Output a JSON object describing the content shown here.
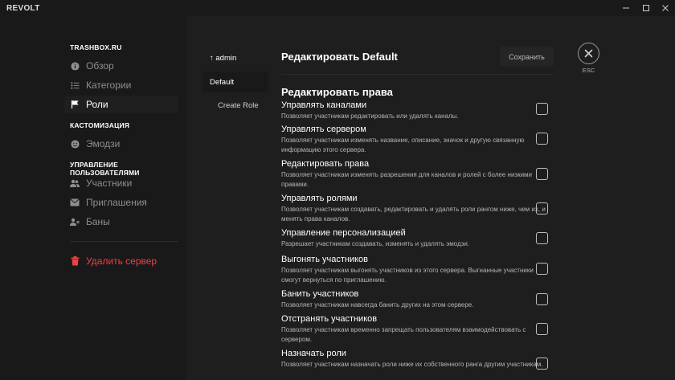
{
  "window": {
    "title": "REVOLT"
  },
  "sidebar": {
    "server_name": "TRASHBOX.RU",
    "items_general": [
      {
        "label": "Обзор",
        "icon": "info-icon"
      },
      {
        "label": "Категории",
        "icon": "list-icon"
      },
      {
        "label": "Роли",
        "icon": "flag-icon",
        "active": true
      }
    ],
    "custom_heading": "КАСТОМИЗАЦИЯ",
    "items_custom": [
      {
        "label": "Эмодзи",
        "icon": "smile-icon"
      }
    ],
    "members_heading": "УПРАВЛЕНИЕ ПОЛЬЗОВАТЕЛЯМИ",
    "items_members": [
      {
        "label": "Участники",
        "icon": "users-icon"
      },
      {
        "label": "Приглашения",
        "icon": "envelope-icon"
      },
      {
        "label": "Баны",
        "icon": "user-ban-icon"
      }
    ],
    "delete_label": "Удалить сервер"
  },
  "roles": {
    "items": [
      {
        "label": "↑ admin"
      },
      {
        "label": "Default",
        "selected": true
      },
      {
        "label": "Create Role"
      }
    ]
  },
  "editor": {
    "title": "Редактировать Default",
    "save_label": "Сохранить",
    "section_title": "Редактировать права",
    "permissions": [
      {
        "name": "Управлять каналами",
        "desc": "Позволяет участникам редактировать или удалять каналы.",
        "checked": false
      },
      {
        "name": "Управлять сервером",
        "desc": "Позволяет участникам изменять название, описание, значок и другую связанную информацию этого сервера.",
        "checked": false
      },
      {
        "name": "Редактировать права",
        "desc": "Позволяет участникам изменять разрешения для каналов и ролей с более низкими правами.",
        "checked": false
      },
      {
        "name": "Управлять ролями",
        "desc": "Позволяет участникам создавать, редактировать и удалять роли рангом ниже, чем их, и менять права каналов.",
        "checked": false
      },
      {
        "name": "Управление персонализацией",
        "desc": "Разрешает участникам создавать, изменять и удалять эмодзи.",
        "checked": false
      },
      {
        "name": "Выгонять участников",
        "desc": "Позволяет участникам выгонять участников из этого сервера. Выгнанные участники смогут вернуться по приглашению.",
        "checked": false
      },
      {
        "name": "Банить участников",
        "desc": "Позволяет участникам навсегда банить других на этом сервере.",
        "checked": false
      },
      {
        "name": "Отстранять участников",
        "desc": "Позволяет участникам временно запрещать пользователям взаимодействовать с сервером.",
        "checked": false
      },
      {
        "name": "Назначать роли",
        "desc": "Позволяет участникам назначать роли ниже их собственного ранга другим участникам.",
        "checked": false
      }
    ]
  },
  "close": {
    "label": "ESC"
  },
  "colors": {
    "background": "#191919",
    "content_bg": "#1e1e1e",
    "danger": "#ed4245",
    "muted_text": "#8f8f8f"
  }
}
